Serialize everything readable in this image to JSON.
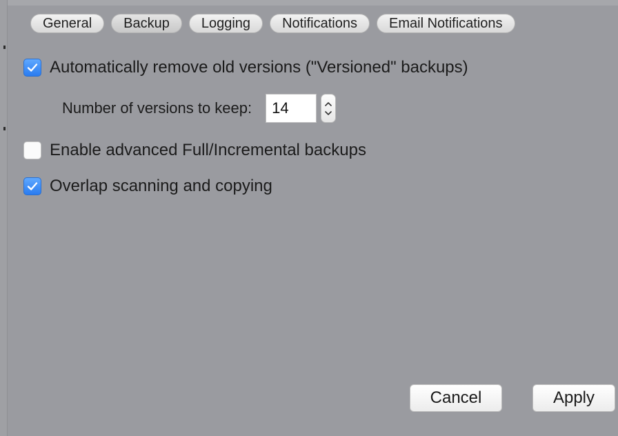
{
  "tabs": [
    {
      "label": "General"
    },
    {
      "label": "Backup",
      "active": true
    },
    {
      "label": "Logging"
    },
    {
      "label": "Notifications"
    },
    {
      "label": "Email Notifications"
    }
  ],
  "options": {
    "auto_remove": {
      "label": "Automatically remove old versions (\"Versioned\" backups)",
      "checked": true
    },
    "versions_label": "Number of versions to keep:",
    "versions_value": "14",
    "advanced": {
      "label": "Enable advanced Full/Incremental backups",
      "checked": false
    },
    "overlap": {
      "label": "Overlap scanning and copying",
      "checked": true
    }
  },
  "buttons": {
    "cancel": "Cancel",
    "apply": "Apply"
  },
  "colors": {
    "background": "#9a9ba0",
    "checkbox_accent": "#2a7cf0"
  },
  "icons": {
    "check": "checkmark-icon",
    "stepper_up": "chevron-up-icon",
    "stepper_down": "chevron-down-icon"
  }
}
